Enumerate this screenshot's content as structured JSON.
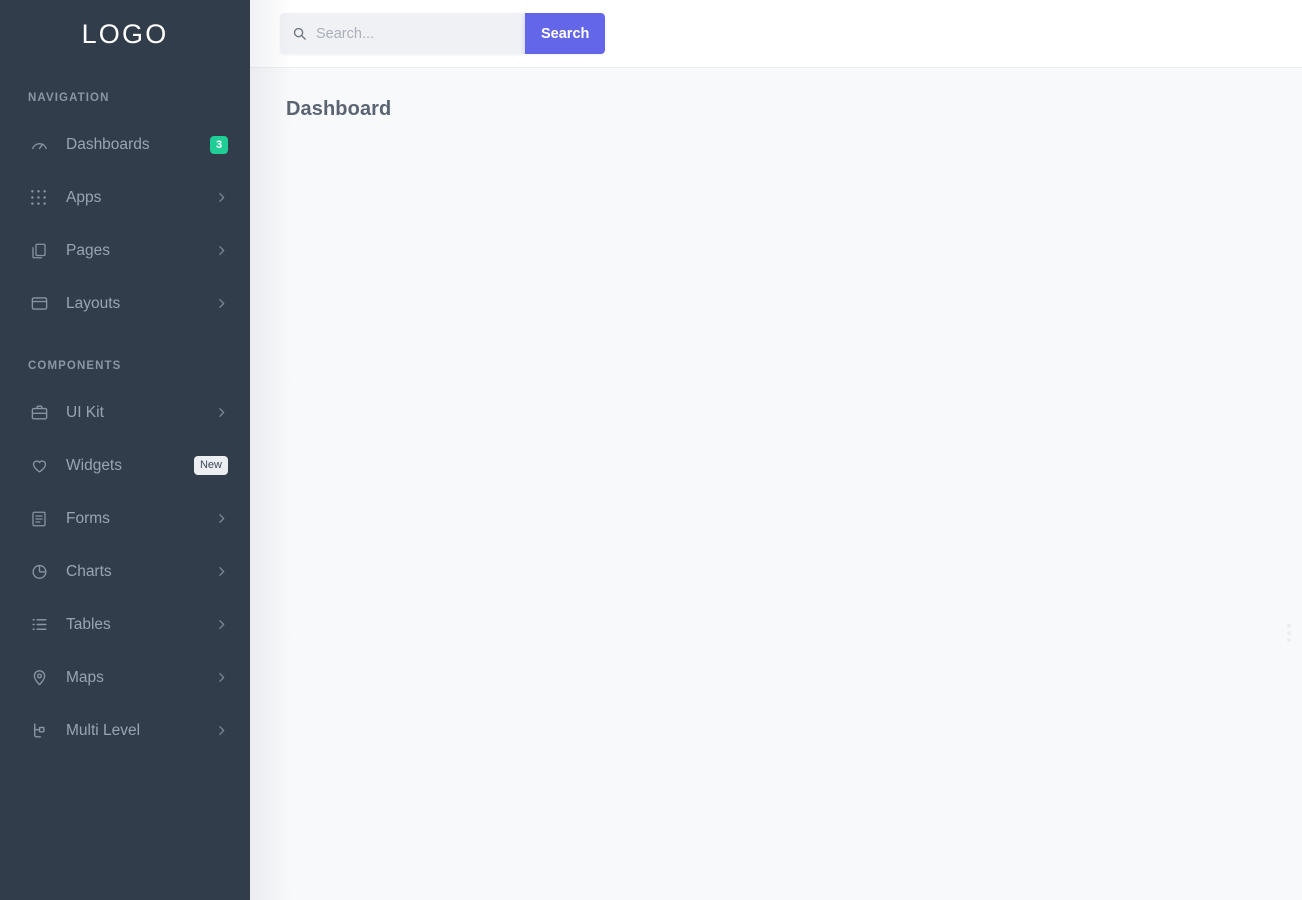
{
  "sidebar": {
    "logo": "LOGO",
    "sections": [
      {
        "label": "NAVIGATION",
        "items": [
          {
            "label": "Dashboards",
            "icon": "gauge-icon",
            "badge": "3",
            "badge_type": "count",
            "chevron": false
          },
          {
            "label": "Apps",
            "icon": "grid-dots-icon",
            "badge": "",
            "badge_type": "none",
            "chevron": true
          },
          {
            "label": "Pages",
            "icon": "copy-files-icon",
            "badge": "",
            "badge_type": "none",
            "chevron": true
          },
          {
            "label": "Layouts",
            "icon": "window-layout-icon",
            "badge": "",
            "badge_type": "none",
            "chevron": true
          }
        ]
      },
      {
        "label": "COMPONENTS",
        "items": [
          {
            "label": "UI Kit",
            "icon": "briefcase-icon",
            "badge": "",
            "badge_type": "none",
            "chevron": true
          },
          {
            "label": "Widgets",
            "icon": "heart-icon",
            "badge": "New",
            "badge_type": "new",
            "chevron": false
          },
          {
            "label": "Forms",
            "icon": "form-document-icon",
            "badge": "",
            "badge_type": "none",
            "chevron": true
          },
          {
            "label": "Charts",
            "icon": "pie-chart-icon",
            "badge": "",
            "badge_type": "none",
            "chevron": true
          },
          {
            "label": "Tables",
            "icon": "list-icon",
            "badge": "",
            "badge_type": "none",
            "chevron": true
          },
          {
            "label": "Maps",
            "icon": "map-pin-icon",
            "badge": "",
            "badge_type": "none",
            "chevron": true
          },
          {
            "label": "Multi Level",
            "icon": "tree-branch-icon",
            "badge": "",
            "badge_type": "none",
            "chevron": true
          }
        ]
      }
    ]
  },
  "topbar": {
    "search": {
      "value": "",
      "placeholder": "Search...",
      "button_label": "Search",
      "icon": "search-icon"
    }
  },
  "content": {
    "page_title": "Dashboard"
  },
  "colors": {
    "sidebar_bg": "#323d4c",
    "accent_purple": "#6366e8",
    "badge_green": "#20cd96",
    "badge_new_bg": "#eceef1",
    "content_bg": "#f8f9fb",
    "nav_text": "#9aa4b1",
    "section_label": "#8b95a3",
    "page_title": "#5a6472"
  }
}
